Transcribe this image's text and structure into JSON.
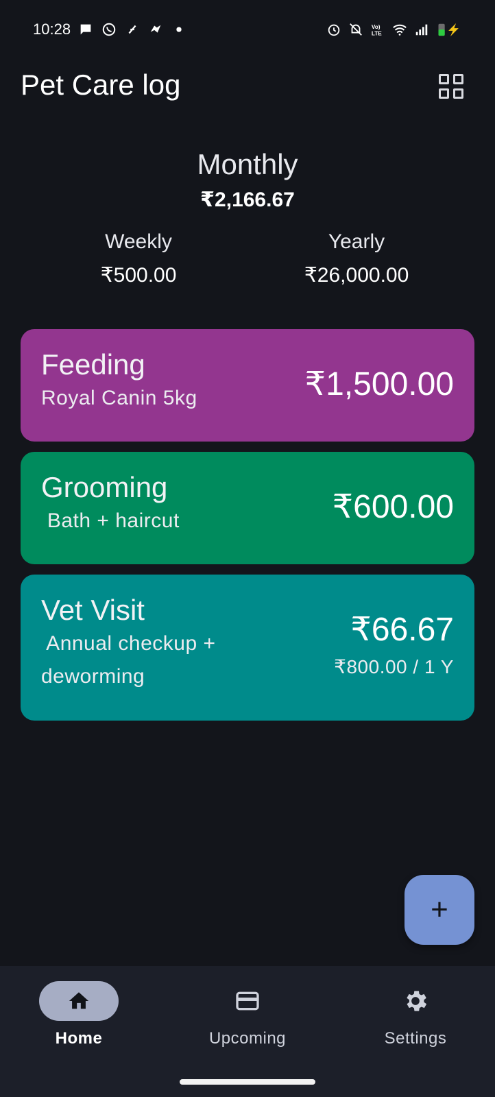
{
  "status_bar": {
    "time": "10:28",
    "left_icons": [
      "chat-bubble-icon",
      "whatsapp-icon",
      "feather-icon",
      "game-icon",
      "dot-icon"
    ],
    "right_icons": [
      "alarm-icon",
      "bell-off-icon",
      "volte-icon",
      "wifi-icon",
      "signal-icon",
      "battery-charging-icon"
    ],
    "volte_text": "Vo) LTE"
  },
  "app_bar": {
    "title": "Pet Care log",
    "layout_icon": "grid-view-icon"
  },
  "summary": {
    "monthly_label": "Monthly",
    "monthly_value": "₹2,166.67",
    "weekly_label": "Weekly",
    "weekly_value": "₹500.00",
    "yearly_label": "Yearly",
    "yearly_value": "₹26,000.00"
  },
  "expenses": [
    {
      "title": "Feeding",
      "note": "Royal Canin 5kg",
      "amount": "₹1,500.00",
      "color": "#93368f"
    },
    {
      "title": "Grooming",
      "note": " Bath + haircut",
      "amount": "₹600.00",
      "color": "#008b5d"
    },
    {
      "title": "Vet Visit",
      "note_line1": " Annual checkup +",
      "note_line2": "deworming",
      "amount": "₹66.67",
      "period": "₹800.00 / 1 Y",
      "color": "#008b8b"
    }
  ],
  "fab": {
    "icon": "plus-icon",
    "label": "+"
  },
  "bottom_nav": [
    {
      "label": "Home",
      "icon": "home-icon",
      "active": true
    },
    {
      "label": "Upcoming",
      "icon": "credit-card-icon",
      "active": false
    },
    {
      "label": "Settings",
      "icon": "gear-icon",
      "active": false
    }
  ],
  "colors": {
    "background": "#13151b",
    "nav_background": "#1c1f29",
    "fab": "#7592d3",
    "active_pill": "#a6adc4"
  }
}
